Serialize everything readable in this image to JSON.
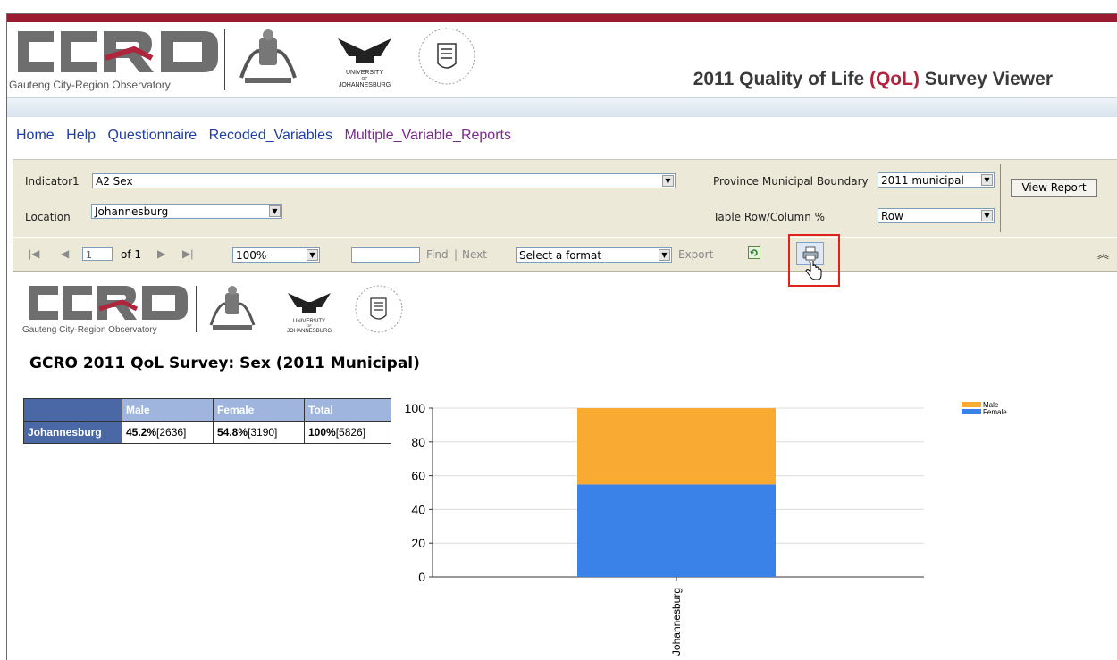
{
  "header": {
    "logo_name": "Gauteng City-Region Observatory",
    "logo_acronym": "GCRO",
    "uj_line1": "UNIVERSITY",
    "uj_line2": "OF",
    "uj_line3": "JOHANNESBURG",
    "title_prefix": "2011 Quality of Life ",
    "title_highlight": "(QoL)",
    "title_suffix": " Survey Viewer"
  },
  "nav": {
    "items": [
      "Home",
      "Help",
      "Questionnaire",
      "Recoded_Variables",
      "Multiple_Variable_Reports"
    ]
  },
  "params": {
    "indicator_label": "Indicator1",
    "indicator_value": "A2 Sex",
    "location_label": "Location",
    "location_value": "Johannesburg",
    "boundary_label": "Province Municipal Boundary",
    "boundary_value": "2011 municipal",
    "rowcol_label": "Table Row/Column %",
    "rowcol_value": "Row",
    "view_report": "View Report"
  },
  "toolbar": {
    "page_value": "1",
    "page_of": "of 1",
    "zoom": "100%",
    "find": "Find",
    "sep": "|",
    "next": "Next",
    "format": "Select a format",
    "export": "Export"
  },
  "report": {
    "title": "GCRO 2011 QoL Survey: Sex (2011 Municipal)",
    "table": {
      "headers": [
        "",
        "Male",
        "Female",
        "Total"
      ],
      "row_label": "Johannesburg",
      "cells": [
        {
          "pct": "45.2%",
          "count": "[2636]"
        },
        {
          "pct": "54.8%",
          "count": "[3190]"
        },
        {
          "pct": "100%",
          "count": "[5826]"
        }
      ]
    }
  },
  "chart_data": {
    "type": "bar",
    "stacked": true,
    "categories": [
      "Johannesburg"
    ],
    "series": [
      {
        "name": "Male",
        "values": [
          45.2
        ],
        "color": "#f9aa33"
      },
      {
        "name": "Female",
        "values": [
          54.8
        ],
        "color": "#3a81e8"
      }
    ],
    "yticks": [
      "0",
      "20",
      "40",
      "60",
      "80",
      "100"
    ],
    "ylim": [
      0,
      100
    ],
    "grid": true,
    "legend": "top-right"
  }
}
